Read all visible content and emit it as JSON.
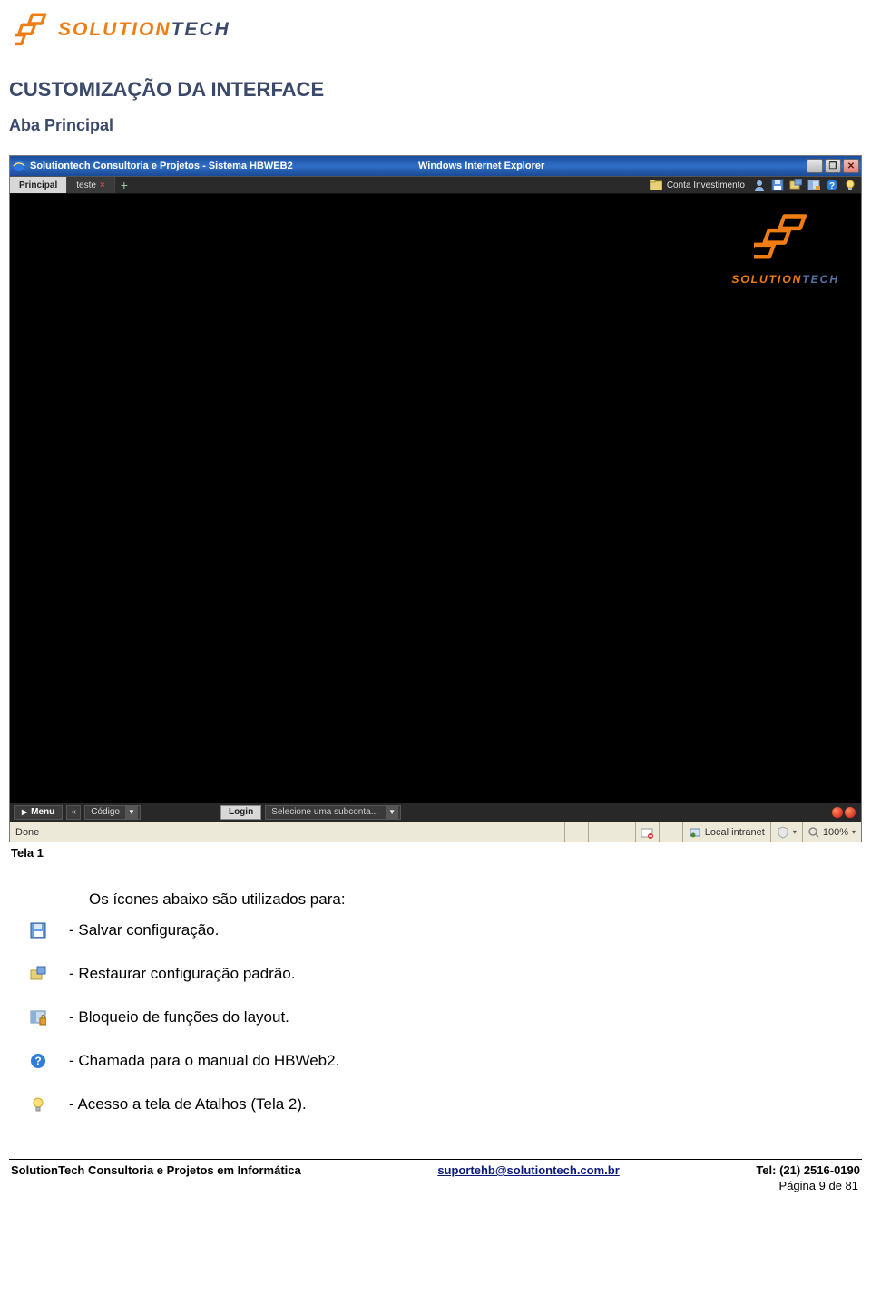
{
  "logo": {
    "prefix": "SOLUTION",
    "suffix": "TECH"
  },
  "section": {
    "title": "CUSTOMIZAÇÃO DA INTERFACE",
    "subtitle": "Aba Principal"
  },
  "window": {
    "title_left": "Solutiontech Consultoria e Projetos - Sistema HBWEB2",
    "title_center": "Windows Internet Explorer",
    "tabs": {
      "principal": "Principal",
      "teste": "teste"
    },
    "account_label": "Conta Investimento",
    "brand": {
      "prefix": "SOLUTION",
      "suffix": "TECH"
    },
    "bottom": {
      "menu": "Menu",
      "codigo": "Código",
      "login": "Login",
      "subconta": "Selecione uma subconta..."
    },
    "status": {
      "done": "Done",
      "zone": "Local intranet",
      "zoom": "100%"
    }
  },
  "caption": "Tela 1",
  "legend": {
    "intro": "Os ícones abaixo são utilizados para:",
    "items": [
      "- Salvar configuração.",
      "- Restaurar configuração padrão.",
      "- Bloqueio de funções do layout.",
      "- Chamada para o manual do HBWeb2.",
      "- Acesso a tela de Atalhos (Tela 2)."
    ]
  },
  "footer": {
    "company": "SolutionTech Consultoria e Projetos em Informática",
    "email": "suportehb@solutiontech.com.br",
    "tel": "Tel: (21) 2516-0190",
    "page": "Página 9 de 81"
  }
}
